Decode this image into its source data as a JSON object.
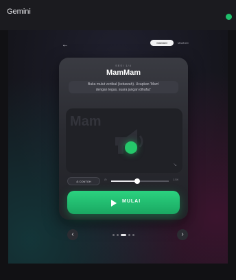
{
  "app": {
    "title": "Gemini"
  },
  "toolbar": {
    "back_glyph": "←",
    "mode_active_label": "MAMAM",
    "mode_other_label": "MAMUM"
  },
  "card": {
    "kicker": "SESI 1/4",
    "title": "MamMam",
    "instruction_line1": "Buka mulut vertikal (kebawah). Ucapkan 'Mam'",
    "instruction_line2": "dengan tegas, suara jangan dihafal.'",
    "visual_word": "Mam",
    "corner_mark": "↘"
  },
  "controls": {
    "example_label": "⎌ CONTOH",
    "speed_min_label": "◷",
    "speed_max_label": "1.5X",
    "speed_level": 0.45,
    "start_label": "MULAI"
  },
  "pager": {
    "prev_glyph": "‹",
    "next_glyph": "›",
    "count": 5,
    "active_index": 2
  },
  "colors": {
    "accent": "#25c76a",
    "background": "#111114",
    "card": "#2a2b31"
  },
  "icons": {
    "megaphone": "megaphone-icon",
    "play": "play-icon"
  }
}
